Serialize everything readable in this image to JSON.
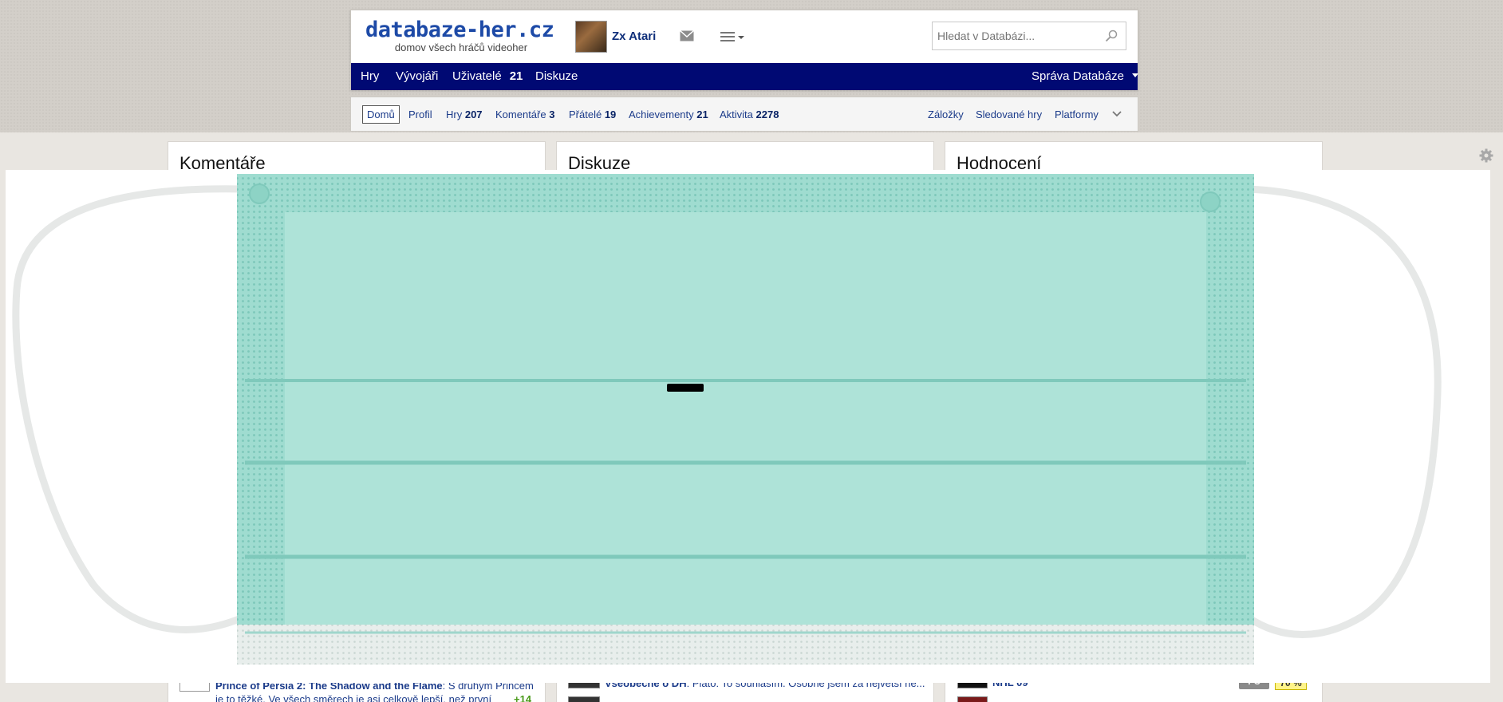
{
  "site": {
    "logo_title": "databaze-her.cz",
    "logo_subtitle": "domov všech hráčů videoher"
  },
  "user": {
    "name": "Zx Atari"
  },
  "search": {
    "placeholder": "Hledat v Databázi..."
  },
  "main_nav": {
    "items": [
      {
        "label": "Hry"
      },
      {
        "label": "Vývojáři"
      },
      {
        "label": "Uživatelé",
        "count": "21"
      },
      {
        "label": "Diskuze"
      }
    ],
    "admin_label": "Správa Databáze"
  },
  "sub_nav": {
    "items": [
      {
        "label": "Domů",
        "count": ""
      },
      {
        "label": "Profil",
        "count": ""
      },
      {
        "label": "Hry",
        "count": "207"
      },
      {
        "label": "Komentáře",
        "count": "3"
      },
      {
        "label": "Přátelé",
        "count": "19"
      },
      {
        "label": "Achievementy",
        "count": "21"
      },
      {
        "label": "Aktivita",
        "count": "2278"
      }
    ],
    "right_items": [
      {
        "label": "Záložky"
      },
      {
        "label": "Sledované hry"
      },
      {
        "label": "Platformy"
      }
    ]
  },
  "panels": [
    {
      "title": "Komentáře"
    },
    {
      "title": "Diskuze"
    },
    {
      "title": "Hodnocení"
    }
  ],
  "visible_rows": {
    "comment": {
      "game": "Prince of Persia 2: The Shadow and the Flame",
      "text": ": S druhým Princem",
      "text2": "je to těžké. Ve všech směrech je asi celkově lepší, než první",
      "score": "+14"
    },
    "discussion": {
      "topic": "Všeobecně o DH",
      "text": ": Plato: To souhlasím. Osobně jsem za největší ne..."
    },
    "rating": {
      "game": "NHL 09",
      "platform": "PC",
      "score": "70 %"
    }
  },
  "colors": {
    "nav_bg": "#000973",
    "link": "#1b3b8a",
    "mask": "#9fdcd0"
  }
}
